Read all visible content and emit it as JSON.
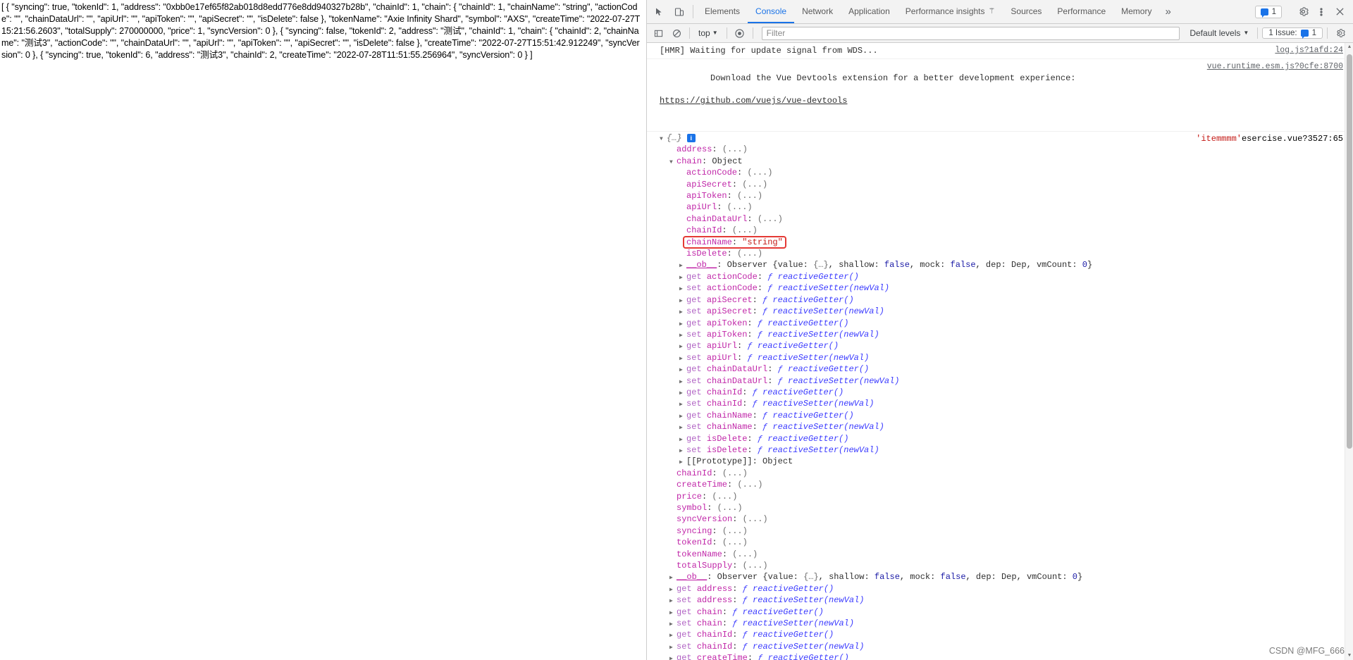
{
  "page": {
    "json_dump": "[ { \"syncing\": true, \"tokenId\": 1, \"address\": \"0xbb0e17ef65f82ab018d8edd776e8dd940327b28b\", \"chainId\": 1, \"chain\": { \"chainId\": 1, \"chainName\": \"string\", \"actionCode\": \"\", \"chainDataUrl\": \"\", \"apiUrl\": \"\", \"apiToken\": \"\", \"apiSecret\": \"\", \"isDelete\": false }, \"tokenName\": \"Axie Infinity Shard\", \"symbol\": \"AXS\", \"createTime\": \"2022-07-27T15:21:56.2603\", \"totalSupply\": 270000000, \"price\": 1, \"syncVersion\": 0 }, { \"syncing\": false, \"tokenId\": 2, \"address\": \"测试\", \"chainId\": 1, \"chain\": { \"chainId\": 2, \"chainName\": \"测试3\", \"actionCode\": \"\", \"chainDataUrl\": \"\", \"apiUrl\": \"\", \"apiToken\": \"\", \"apiSecret\": \"\", \"isDelete\": false }, \"createTime\": \"2022-07-27T15:51:42.912249\", \"syncVersion\": 0 }, { \"syncing\": true, \"tokenId\": 6, \"address\": \"测试3\", \"chainId\": 2, \"createTime\": \"2022-07-28T11:51:55.256964\", \"syncVersion\": 0 } ]"
  },
  "devtools": {
    "tabs": [
      {
        "label": "Elements",
        "active": false
      },
      {
        "label": "Console",
        "active": true
      },
      {
        "label": "Network",
        "active": false
      },
      {
        "label": "Application",
        "active": false
      },
      {
        "label": "Performance insights",
        "active": false,
        "flask": true
      },
      {
        "label": "Sources",
        "active": false
      },
      {
        "label": "Performance",
        "active": false
      },
      {
        "label": "Memory",
        "active": false
      }
    ],
    "more_label": "»",
    "messages_count": "1",
    "icons": {
      "inspect": "inspect-element-icon",
      "device": "device-toolbar-icon",
      "settings": "gear-icon",
      "kebab": "more-options-icon",
      "close": "close-icon",
      "clear_console": "clear-console-icon",
      "sidebar": "console-sidebar-icon",
      "eye": "live-expression-icon",
      "flask": "experiment-flask-icon"
    },
    "filterbar": {
      "context_label": "top",
      "filter_placeholder": "Filter",
      "filter_value": "",
      "levels_label": "Default levels",
      "issues_label": "1 Issue:",
      "issues_count": "1"
    }
  },
  "console": {
    "messages": [
      {
        "text": "[HMR] Waiting for update signal from WDS...",
        "source": "log.js?1afd:24"
      },
      {
        "text": "Download the Vue Devtools extension for a better development experience:",
        "link": "https://github.com/vuejs/vue-devtools",
        "source": "vue.runtime.esm.js?0cfe:8700"
      }
    ],
    "object_entry": {
      "collapse_glyph": "{…}",
      "info_badge": "i",
      "label": "'itemmmm'",
      "source": "esercise.vue?3527:65"
    },
    "tree": [
      {
        "indent": 1,
        "arrow": "none",
        "key": "address",
        "sep": ": ",
        "value": "(...)",
        "vtype": "dim"
      },
      {
        "indent": 1,
        "arrow": "down",
        "key": "chain",
        "sep": ": ",
        "value": "Object",
        "vtype": "plain"
      },
      {
        "indent": 2,
        "arrow": "none",
        "key": "actionCode",
        "sep": ": ",
        "value": "(...)",
        "vtype": "dim"
      },
      {
        "indent": 2,
        "arrow": "none",
        "key": "apiSecret",
        "sep": ": ",
        "value": "(...)",
        "vtype": "dim"
      },
      {
        "indent": 2,
        "arrow": "none",
        "key": "apiToken",
        "sep": ": ",
        "value": "(...)",
        "vtype": "dim"
      },
      {
        "indent": 2,
        "arrow": "none",
        "key": "apiUrl",
        "sep": ": ",
        "value": "(...)",
        "vtype": "dim"
      },
      {
        "indent": 2,
        "arrow": "none",
        "key": "chainDataUrl",
        "sep": ": ",
        "value": "(...)",
        "vtype": "dim"
      },
      {
        "indent": 2,
        "arrow": "none",
        "key": "chainId",
        "sep": ": ",
        "value": "(...)",
        "vtype": "dim"
      },
      {
        "indent": 2,
        "arrow": "none",
        "key": "chainName",
        "sep": ": ",
        "value": "\"string\"",
        "vtype": "str",
        "highlight": true
      },
      {
        "indent": 2,
        "arrow": "none",
        "key": "isDelete",
        "sep": ": ",
        "value": "(...)",
        "vtype": "dim"
      },
      {
        "indent": 2,
        "arrow": "right",
        "key": "__ob__",
        "sep": ": ",
        "value": "observer",
        "vtype": "observer"
      },
      {
        "indent": 2,
        "arrow": "right",
        "prefix": "get ",
        "key": "actionCode",
        "sep": ": ",
        "value": "ƒ reactiveGetter()",
        "vtype": "fn"
      },
      {
        "indent": 2,
        "arrow": "right",
        "prefix": "set ",
        "key": "actionCode",
        "sep": ": ",
        "value": "ƒ reactiveSetter(newVal)",
        "vtype": "fn"
      },
      {
        "indent": 2,
        "arrow": "right",
        "prefix": "get ",
        "key": "apiSecret",
        "sep": ": ",
        "value": "ƒ reactiveGetter()",
        "vtype": "fn"
      },
      {
        "indent": 2,
        "arrow": "right",
        "prefix": "set ",
        "key": "apiSecret",
        "sep": ": ",
        "value": "ƒ reactiveSetter(newVal)",
        "vtype": "fn"
      },
      {
        "indent": 2,
        "arrow": "right",
        "prefix": "get ",
        "key": "apiToken",
        "sep": ": ",
        "value": "ƒ reactiveGetter()",
        "vtype": "fn"
      },
      {
        "indent": 2,
        "arrow": "right",
        "prefix": "set ",
        "key": "apiToken",
        "sep": ": ",
        "value": "ƒ reactiveSetter(newVal)",
        "vtype": "fn"
      },
      {
        "indent": 2,
        "arrow": "right",
        "prefix": "get ",
        "key": "apiUrl",
        "sep": ": ",
        "value": "ƒ reactiveGetter()",
        "vtype": "fn"
      },
      {
        "indent": 2,
        "arrow": "right",
        "prefix": "set ",
        "key": "apiUrl",
        "sep": ": ",
        "value": "ƒ reactiveSetter(newVal)",
        "vtype": "fn"
      },
      {
        "indent": 2,
        "arrow": "right",
        "prefix": "get ",
        "key": "chainDataUrl",
        "sep": ": ",
        "value": "ƒ reactiveGetter()",
        "vtype": "fn"
      },
      {
        "indent": 2,
        "arrow": "right",
        "prefix": "set ",
        "key": "chainDataUrl",
        "sep": ": ",
        "value": "ƒ reactiveSetter(newVal)",
        "vtype": "fn"
      },
      {
        "indent": 2,
        "arrow": "right",
        "prefix": "get ",
        "key": "chainId",
        "sep": ": ",
        "value": "ƒ reactiveGetter()",
        "vtype": "fn"
      },
      {
        "indent": 2,
        "arrow": "right",
        "prefix": "set ",
        "key": "chainId",
        "sep": ": ",
        "value": "ƒ reactiveSetter(newVal)",
        "vtype": "fn"
      },
      {
        "indent": 2,
        "arrow": "right",
        "prefix": "get ",
        "key": "chainName",
        "sep": ": ",
        "value": "ƒ reactiveGetter()",
        "vtype": "fn"
      },
      {
        "indent": 2,
        "arrow": "right",
        "prefix": "set ",
        "key": "chainName",
        "sep": ": ",
        "value": "ƒ reactiveSetter(newVal)",
        "vtype": "fn"
      },
      {
        "indent": 2,
        "arrow": "right",
        "prefix": "get ",
        "key": "isDelete",
        "sep": ": ",
        "value": "ƒ reactiveGetter()",
        "vtype": "fn"
      },
      {
        "indent": 2,
        "arrow": "right",
        "prefix": "set ",
        "key": "isDelete",
        "sep": ": ",
        "value": "ƒ reactiveSetter(newVal)",
        "vtype": "fn"
      },
      {
        "indent": 2,
        "arrow": "right",
        "key": "[[Prototype]]",
        "sep": ": ",
        "value": "Object",
        "vtype": "proto"
      },
      {
        "indent": 1,
        "arrow": "none",
        "key": "chainId",
        "sep": ": ",
        "value": "(...)",
        "vtype": "dim"
      },
      {
        "indent": 1,
        "arrow": "none",
        "key": "createTime",
        "sep": ": ",
        "value": "(...)",
        "vtype": "dim"
      },
      {
        "indent": 1,
        "arrow": "none",
        "key": "price",
        "sep": ": ",
        "value": "(...)",
        "vtype": "dim"
      },
      {
        "indent": 1,
        "arrow": "none",
        "key": "symbol",
        "sep": ": ",
        "value": "(...)",
        "vtype": "dim"
      },
      {
        "indent": 1,
        "arrow": "none",
        "key": "syncVersion",
        "sep": ": ",
        "value": "(...)",
        "vtype": "dim"
      },
      {
        "indent": 1,
        "arrow": "none",
        "key": "syncing",
        "sep": ": ",
        "value": "(...)",
        "vtype": "dim"
      },
      {
        "indent": 1,
        "arrow": "none",
        "key": "tokenId",
        "sep": ": ",
        "value": "(...)",
        "vtype": "dim"
      },
      {
        "indent": 1,
        "arrow": "none",
        "key": "tokenName",
        "sep": ": ",
        "value": "(...)",
        "vtype": "dim"
      },
      {
        "indent": 1,
        "arrow": "none",
        "key": "totalSupply",
        "sep": ": ",
        "value": "(...)",
        "vtype": "dim"
      },
      {
        "indent": 1,
        "arrow": "right",
        "key": "__ob__",
        "sep": ": ",
        "value": "observer",
        "vtype": "observer"
      },
      {
        "indent": 1,
        "arrow": "right",
        "prefix": "get ",
        "key": "address",
        "sep": ": ",
        "value": "ƒ reactiveGetter()",
        "vtype": "fn"
      },
      {
        "indent": 1,
        "arrow": "right",
        "prefix": "set ",
        "key": "address",
        "sep": ": ",
        "value": "ƒ reactiveSetter(newVal)",
        "vtype": "fn"
      },
      {
        "indent": 1,
        "arrow": "right",
        "prefix": "get ",
        "key": "chain",
        "sep": ": ",
        "value": "ƒ reactiveGetter()",
        "vtype": "fn"
      },
      {
        "indent": 1,
        "arrow": "right",
        "prefix": "set ",
        "key": "chain",
        "sep": ": ",
        "value": "ƒ reactiveSetter(newVal)",
        "vtype": "fn"
      },
      {
        "indent": 1,
        "arrow": "right",
        "prefix": "get ",
        "key": "chainId",
        "sep": ": ",
        "value": "ƒ reactiveGetter()",
        "vtype": "fn"
      },
      {
        "indent": 1,
        "arrow": "right",
        "prefix": "set ",
        "key": "chainId",
        "sep": ": ",
        "value": "ƒ reactiveSetter(newVal)",
        "vtype": "fn"
      },
      {
        "indent": 1,
        "arrow": "right",
        "prefix": "get ",
        "key": "createTime",
        "sep": ": ",
        "value": "ƒ reactiveGetter()",
        "vtype": "fn"
      }
    ],
    "observer_parts": {
      "name": "Observer ",
      "open": "{",
      "value_key": "value: ",
      "value_val": "{…}",
      "shallow_key": ", shallow: ",
      "shallow_val": "false",
      "mock_key": ", mock: ",
      "mock_val": "false",
      "dep_key": ", dep: ",
      "dep_val": "Dep",
      "vm_key": ", vmCount: ",
      "vm_val": "0",
      "close": "}"
    }
  },
  "watermark": "CSDN @MFG_666",
  "colors": {
    "accent": "#1a73e8",
    "highlight_box": "#e53935",
    "string_red": "#c41a16",
    "key_purple": "#c026a8",
    "bool_blue": "#1a1aa6"
  }
}
